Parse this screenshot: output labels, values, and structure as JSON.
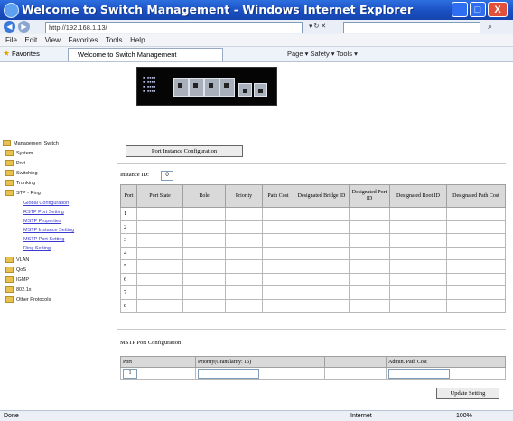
{
  "window": {
    "title": "Welcome to Switch Management - Windows Internet Explorer",
    "minimize_label": "_",
    "maximize_label": "□",
    "close_label": "X"
  },
  "address_bar": {
    "url": "http://192.168.1.13/"
  },
  "menu": {
    "items": [
      "File",
      "Edit",
      "View",
      "Favorites",
      "Tools",
      "Help"
    ]
  },
  "favorites_bar": {
    "label": "Favorites",
    "tab_title": "Welcome to Switch Management",
    "tools_text": "Page ▾  Safety ▾  Tools ▾"
  },
  "sidebar": {
    "items": [
      {
        "label": "Management Switch",
        "level": 0,
        "link": false
      },
      {
        "label": "System",
        "level": 1,
        "link": false
      },
      {
        "label": "Port",
        "level": 1,
        "link": false
      },
      {
        "label": "Switching",
        "level": 1,
        "link": false
      },
      {
        "label": "Trunking",
        "level": 1,
        "link": false
      },
      {
        "label": "STP - Ring",
        "level": 1,
        "link": false
      },
      {
        "label": "Global Configuration",
        "level": 2,
        "link": true
      },
      {
        "label": "RSTP Port Setting",
        "level": 2,
        "link": true
      },
      {
        "label": "MSTP Properties",
        "level": 2,
        "link": true
      },
      {
        "label": "MSTP Instance Setting",
        "level": 2,
        "link": true
      },
      {
        "label": "MSTP Port Setting",
        "level": 2,
        "link": true
      },
      {
        "label": "Ring Setting",
        "level": 2,
        "link": true
      },
      {
        "label": "VLAN",
        "level": 1,
        "link": false
      },
      {
        "label": "QoS",
        "level": 1,
        "link": false
      },
      {
        "label": "IGMP",
        "level": 1,
        "link": false
      },
      {
        "label": "802.1x",
        "level": 1,
        "link": false
      },
      {
        "label": "Other Protocols",
        "level": 1,
        "link": false
      }
    ]
  },
  "content": {
    "instance_button": "Port Instance Configuration",
    "instance_label": "Instance ID:",
    "instance_value": "0",
    "table": {
      "columns": [
        "Port",
        "Port State",
        "Role",
        "Priority",
        "Path Cost",
        "Designated Bridge ID",
        "Designated Port ID",
        "Designated Root ID",
        "Designated Path Cost"
      ],
      "rows": [
        "1",
        "2",
        "3",
        "4",
        "5",
        "6",
        "7",
        "8"
      ]
    },
    "mstp_title": "MSTP Port Configuration",
    "mstp_columns": [
      "Port",
      "Priority(Granularity: 16)",
      "",
      "Admin. Path Cost"
    ],
    "mstp_port_value": "1",
    "update_button": "Update Setting"
  },
  "statusbar": {
    "left": "Done",
    "zone": "Internet",
    "zoom": "100%"
  }
}
